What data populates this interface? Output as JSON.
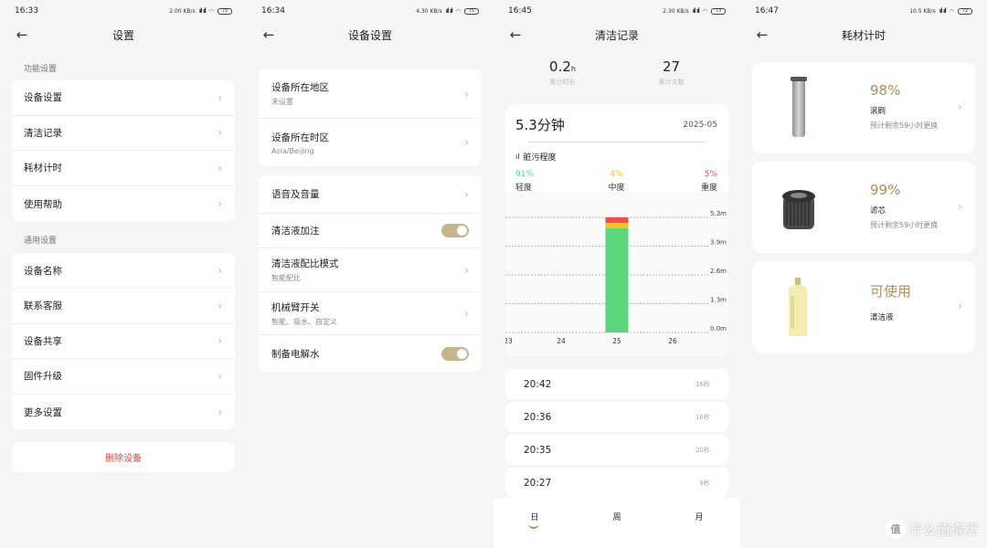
{
  "screen1": {
    "time": "16:33",
    "net": "2.00 KB/s",
    "battery": "75",
    "title": "设置",
    "section1": "功能设置",
    "items1": [
      "设备设置",
      "清洁记录",
      "耗材计时",
      "使用帮助"
    ],
    "section2": "通用设置",
    "items2": [
      "设备名称",
      "联系客服",
      "设备共享",
      "固件升级",
      "更多设置"
    ],
    "delete": "删除设备"
  },
  "screen2": {
    "time": "16:34",
    "net": "4.30 KB/s",
    "battery": "75",
    "title": "设备设置",
    "region_label": "设备所在地区",
    "region_value": "未设置",
    "tz_label": "设备所在时区",
    "tz_value": "Asia/Beijing",
    "voice": "语音及音量",
    "detergent": "清洁液加注",
    "ratio_label": "清洁液配比模式",
    "ratio_value": "智能配比",
    "arm_label": "机械臂开关",
    "arm_value": "智能、吸水、自定义",
    "electro": "制备电解水"
  },
  "screen3": {
    "time": "16:45",
    "net": "2.30 KB/s",
    "battery": "73",
    "title": "清洁记录",
    "total_time": "0.2",
    "total_time_unit": "h",
    "total_time_label": "累计时长",
    "total_count": "27",
    "total_count_label": "累计次数",
    "duration": "5.3分钟",
    "date": "2025-05",
    "dirt_title": "脏污程度",
    "levels": [
      {
        "pct": "91%",
        "name": "轻度",
        "color": "#5bd67c"
      },
      {
        "pct": "4%",
        "name": "中度",
        "color": "#f2c12e"
      },
      {
        "pct": "5%",
        "name": "重度",
        "color": "#ee4d4d"
      }
    ],
    "records": [
      {
        "time": "20:42",
        "dur": "16秒"
      },
      {
        "time": "20:36",
        "dur": "16秒"
      },
      {
        "time": "20:35",
        "dur": "20秒"
      },
      {
        "time": "20:27",
        "dur": "8秒"
      }
    ],
    "tabs": [
      "日",
      "周",
      "月"
    ]
  },
  "screen4": {
    "time": "16:47",
    "net": "10.5 KB/s",
    "battery": "72",
    "title": "耗材计时",
    "items": [
      {
        "value": "98%",
        "name": "滚刷",
        "sub": "预计剩余59小时更换"
      },
      {
        "value": "99%",
        "name": "滤芯",
        "sub": "预计剩余59小时更换"
      },
      {
        "value": "可使用",
        "name": "清洁液",
        "sub": ""
      }
    ]
  },
  "chart_data": {
    "type": "bar",
    "categories": [
      "23",
      "24",
      "25",
      "26"
    ],
    "yticks": [
      "0.0m",
      "1.3m",
      "2.6m",
      "3.9m",
      "5.3m"
    ],
    "ylim": [
      0,
      5.3
    ],
    "series": [
      {
        "name": "轻度",
        "values": [
          0,
          0,
          4.8,
          0
        ],
        "color": "#5bd67c"
      },
      {
        "name": "中度",
        "values": [
          0,
          0,
          0.25,
          0
        ],
        "color": "#f2c12e"
      },
      {
        "name": "重度",
        "values": [
          0,
          0,
          0.25,
          0
        ],
        "color": "#ee4d4d"
      }
    ]
  },
  "watermark": {
    "badge": "值",
    "text": "什么值得买"
  }
}
